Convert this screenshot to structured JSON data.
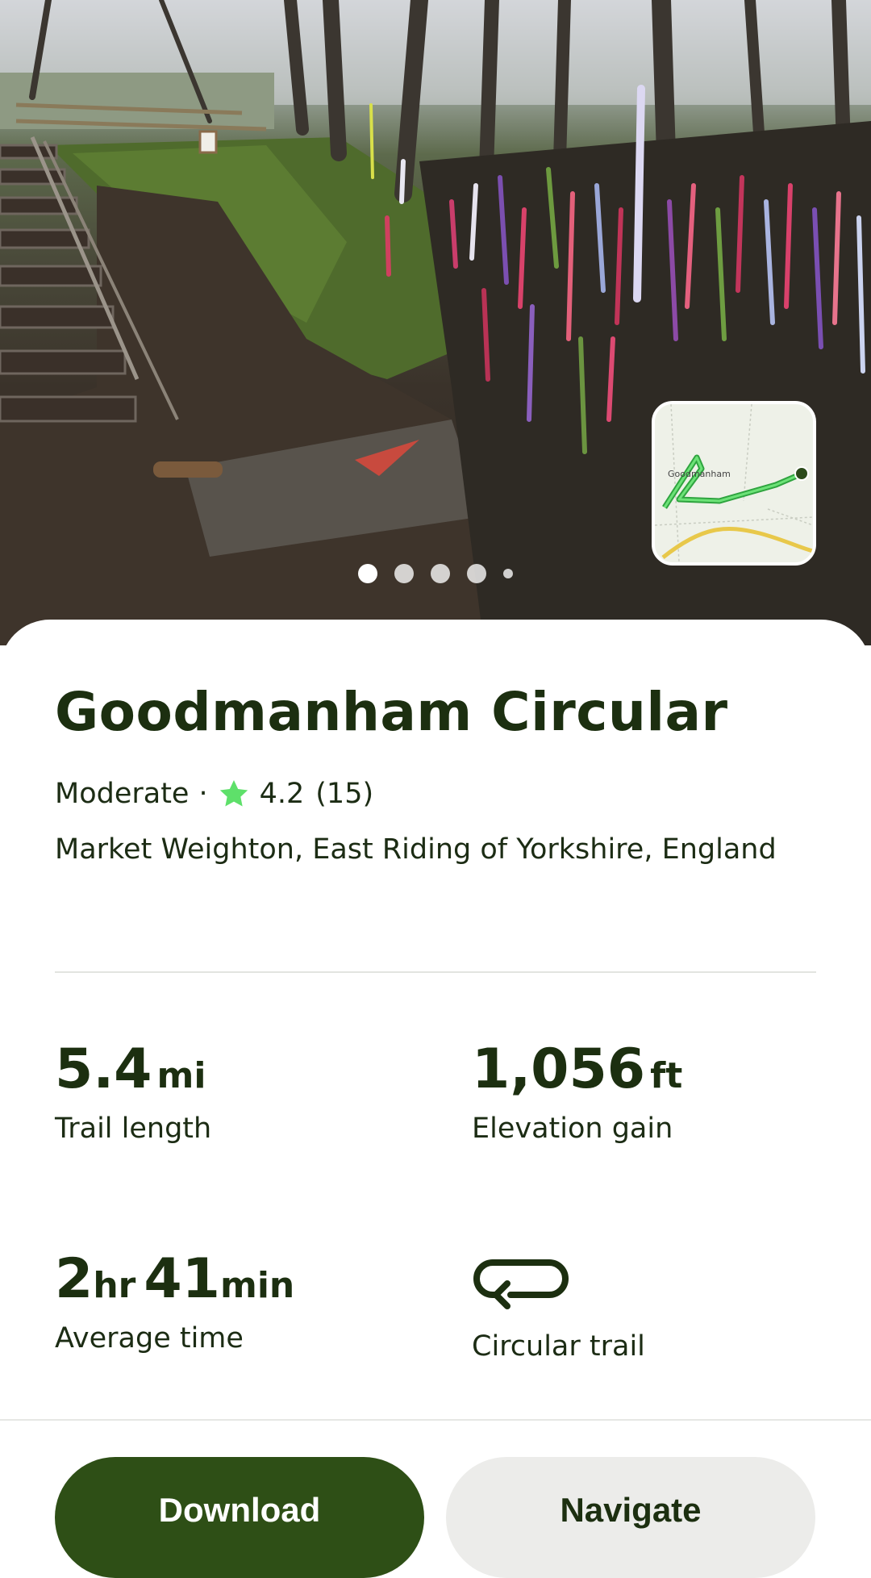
{
  "hero": {
    "photo_icon": "trail-photo",
    "carousel": {
      "count": 5,
      "active_index": 0
    },
    "minimap": {
      "icon": "route-map",
      "place_label": "Goodmanham",
      "route_color": "#39d353",
      "road_color": "#e8c84a"
    }
  },
  "trail": {
    "name": "Goodmanham Circular",
    "difficulty": "Moderate",
    "separator": "·",
    "rating": "4.2",
    "review_count": "(15)",
    "location": "Market Weighton, East Riding of Yorkshire, England"
  },
  "stats": {
    "length": {
      "value": "5.4",
      "unit": "mi",
      "label": "Trail length"
    },
    "elevation": {
      "value": "1,056",
      "unit": "ft",
      "label": "Elevation gain"
    },
    "time": {
      "hours": "2",
      "hours_unit": "hr",
      "minutes": "41",
      "minutes_unit": "min",
      "label": "Average time"
    },
    "route_type": {
      "icon": "loop-arrow-icon",
      "label": "Circular trail"
    }
  },
  "actions": {
    "download_label": "Download",
    "navigate_label": "Navigate"
  },
  "colors": {
    "brand_dark": "#2e4f16",
    "star": "#5ee06a",
    "text": "#1c2f10",
    "secondary_button": "#ececea"
  }
}
